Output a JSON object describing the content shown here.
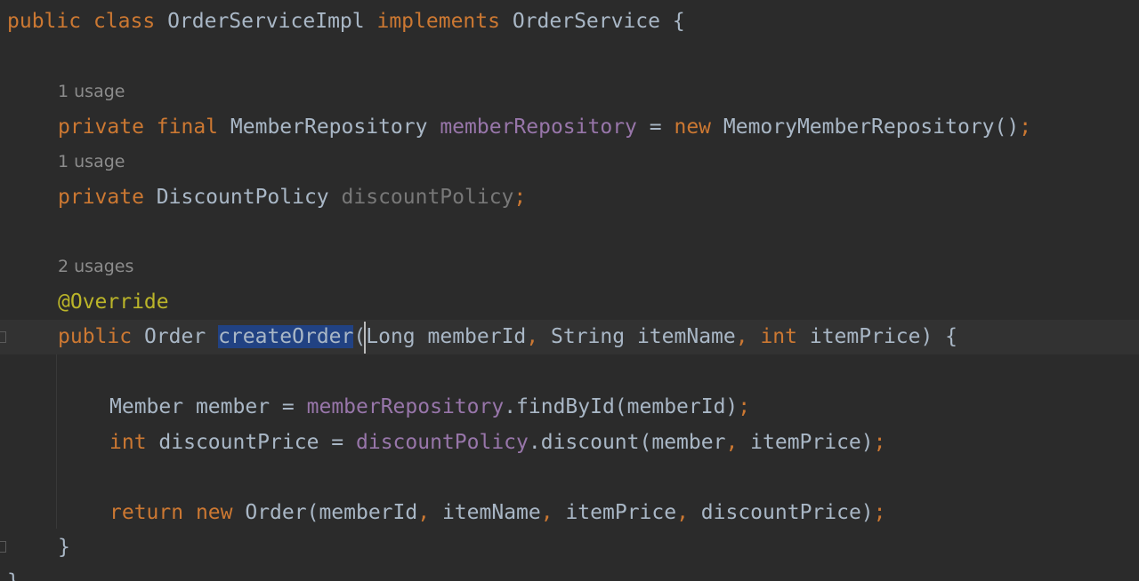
{
  "code": {
    "class_decl": {
      "kw_public": "public",
      "kw_class": "class",
      "class_name": "OrderServiceImpl",
      "kw_implements": "implements",
      "interface_name": "OrderService",
      "brace_open": "{"
    },
    "hint_1": "1 usage",
    "field_1": {
      "kw_private": "private",
      "kw_final": "final",
      "type": "MemberRepository",
      "name": "memberRepository",
      "equals": "=",
      "kw_new": "new",
      "ctor": "MemoryMemberRepository()",
      "semi": ";"
    },
    "hint_2": "1 usage",
    "field_2": {
      "kw_private": "private",
      "type": "DiscountPolicy",
      "name": "discountPolicy",
      "semi": ";"
    },
    "hint_3": "2 usages",
    "annotation": "@Override",
    "method_decl": {
      "kw_public": "public",
      "return_type": "Order",
      "method_name": "createOrder",
      "paren_open": "(",
      "p1_type": "Long",
      "p1_name": "memberId",
      "comma1": ",",
      "p2_type": "String",
      "p2_name": "itemName",
      "comma2": ",",
      "p3_type": "int",
      "p3_name": "itemPrice",
      "close": ") {"
    },
    "stmt_1": {
      "type": "Member",
      "var": "member",
      "equals": "=",
      "field": "memberRepository",
      "call": ".findById(memberId)",
      "semi": ";"
    },
    "stmt_2": {
      "kw_int": "int",
      "var": "discountPrice",
      "equals": "=",
      "field": "discountPolicy",
      "call_a": ".discount(member",
      "comma": ",",
      "call_b": "itemPrice)",
      "semi": ";"
    },
    "stmt_3": {
      "kw_return": "return",
      "kw_new": "new",
      "call_a": "Order(memberId",
      "comma1": ",",
      "arg2": "itemName",
      "comma2": ",",
      "arg3": "itemPrice",
      "comma3": ",",
      "call_b": "discountPrice)",
      "semi": ";"
    },
    "method_close": "}",
    "class_close": "}"
  },
  "colors": {
    "background": "#2b2b2b",
    "keyword": "#cc7832",
    "identifier": "#a9b7c6",
    "field": "#9876aa",
    "unused_field": "#787878",
    "annotation": "#bbb529",
    "inlay_hint": "#8c8c8c",
    "selection": "#214283"
  }
}
